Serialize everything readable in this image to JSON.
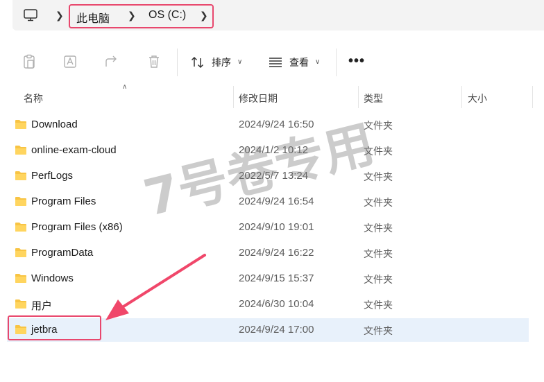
{
  "breadcrumb": {
    "items": [
      "此电脑",
      "OS (C:)"
    ]
  },
  "toolbar": {
    "sort_label": "排序",
    "view_label": "查看",
    "more_label": "•••"
  },
  "columns": {
    "name": "名称",
    "modified": "修改日期",
    "type": "类型",
    "size": "大小"
  },
  "files": [
    {
      "name": "Download",
      "modified": "2024/9/24 16:50",
      "type": "文件夹"
    },
    {
      "name": "online-exam-cloud",
      "modified": "2024/1/2 10:12",
      "type": "文件夹"
    },
    {
      "name": "PerfLogs",
      "modified": "2022/5/7 13:24",
      "type": "文件夹"
    },
    {
      "name": "Program Files",
      "modified": "2024/9/24 16:54",
      "type": "文件夹"
    },
    {
      "name": "Program Files (x86)",
      "modified": "2024/9/10 19:01",
      "type": "文件夹"
    },
    {
      "name": "ProgramData",
      "modified": "2024/9/24 16:22",
      "type": "文件夹"
    },
    {
      "name": "Windows",
      "modified": "2024/9/15 15:37",
      "type": "文件夹"
    },
    {
      "name": "用户",
      "modified": "2024/6/30 10:04",
      "type": "文件夹"
    },
    {
      "name": "jetbra",
      "modified": "2024/9/24 17:00",
      "type": "文件夹"
    }
  ],
  "watermark": "7号卷专用",
  "colors": {
    "highlight": "#e8476d",
    "folder": "#f8c444",
    "selected_row": "#e8f1fb"
  }
}
